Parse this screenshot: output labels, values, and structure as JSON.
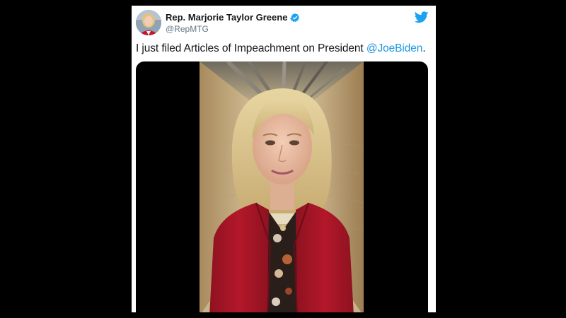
{
  "tweet": {
    "author_name": "Rep. Marjorie Taylor Greene",
    "author_handle": "@RepMTG",
    "verified": true,
    "text_before": "I just filed Articles of Impeachment on President ",
    "mention": "@JoeBiden",
    "text_after": ".",
    "icons": {
      "brand": "twitter-bird-icon",
      "verified": "verified-badge-icon"
    },
    "colors": {
      "link": "#1b95e0",
      "verified": "#1da1f2",
      "twitter_blue": "#1da1f2",
      "jacket": "#b3182a"
    }
  }
}
